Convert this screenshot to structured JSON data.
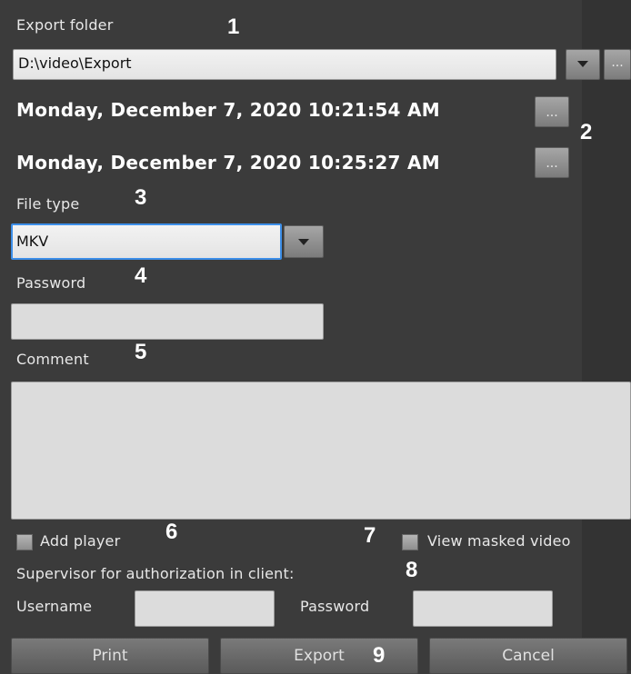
{
  "export_folder": {
    "label": "Export folder",
    "value": "D:\\video\\Export",
    "browse": "..."
  },
  "dates": {
    "start": "Monday, December 7, 2020 10:21:54 AM",
    "end": "Monday, December 7, 2020 10:25:27 AM",
    "picker": "..."
  },
  "file_type": {
    "label": "File type",
    "value": "MKV"
  },
  "password": {
    "label": "Password",
    "value": ""
  },
  "comment": {
    "label": "Comment",
    "value": ""
  },
  "add_player": {
    "label": "Add player",
    "checked": false
  },
  "view_masked": {
    "label": "View masked video",
    "checked": false
  },
  "supervisor": {
    "label": "Supervisor for authorization in client:",
    "username_label": "Username",
    "password_label": "Password",
    "username": "",
    "password": ""
  },
  "buttons": {
    "print": "Print",
    "export": "Export",
    "cancel": "Cancel"
  },
  "callouts": [
    "1",
    "2",
    "3",
    "4",
    "5",
    "6",
    "7",
    "8",
    "9"
  ]
}
